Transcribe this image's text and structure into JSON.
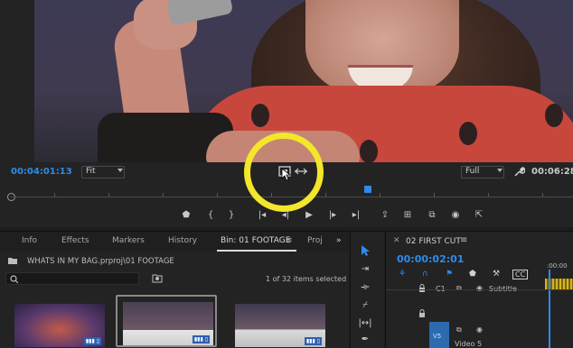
{
  "monitor": {
    "timecode_left": "00:04:01:13",
    "fit": "Fit",
    "quality": "Full",
    "timecode_right": "00:06:28:"
  },
  "panel": {
    "tabs": [
      "Info",
      "Effects",
      "Markers",
      "History",
      "Bin: 01 FOOTAGE",
      "Proj"
    ],
    "more": "»",
    "path": "WHATS IN MY BAG.prproj\\01 FOOTAGE",
    "items_count": "1 of 32 items selected",
    "thumbs": [
      {
        "badge": "▮▮▮ ▯"
      },
      {
        "badge": "▮▮▮ ▯"
      },
      {
        "badge": "▮▮▮ ▯"
      }
    ]
  },
  "timeline": {
    "title": "02 FIRST CUT",
    "timecode": "00:00:02:01",
    "ruler_label": ":00:00",
    "tracks": {
      "c1_label": "C1",
      "subtitle_label": "Subtitle",
      "v5_label": "V5",
      "video5_label": "Video 5"
    }
  },
  "colors": {
    "accent": "#2d8ceb",
    "highlight": "#f3e62b"
  }
}
